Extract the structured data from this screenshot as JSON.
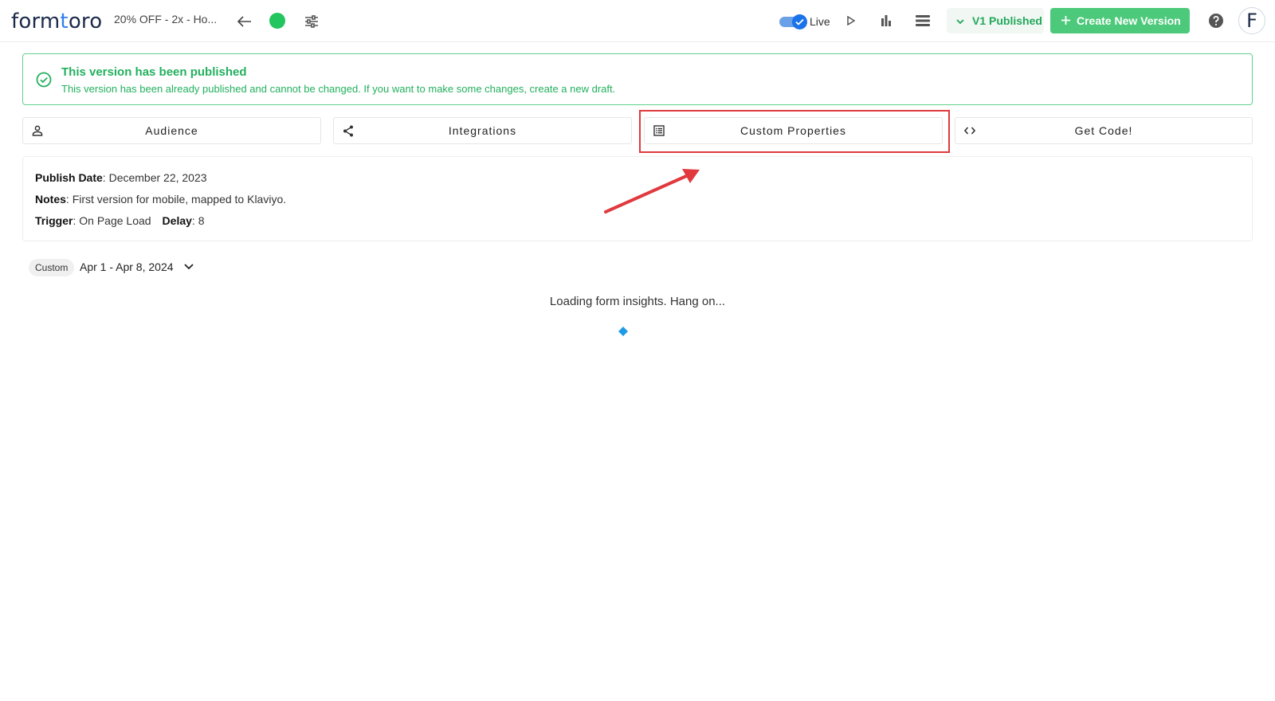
{
  "header": {
    "logo_prefix": "form",
    "logo_mid": "t",
    "logo_suffix": "oro",
    "form_name": "20% OFF - 2x - Ho...",
    "live_label": "Live",
    "version_label": "V1 Published",
    "create_label": "Create New Version",
    "avatar_letter": "F",
    "status_color": "#22c55e"
  },
  "notice": {
    "title": "This version has been published",
    "text": "This version has been already published and cannot be changed. If you want to make some changes, create a new draft."
  },
  "tabs": [
    {
      "label": "Audience",
      "icon": "person-icon"
    },
    {
      "label": "Integrations",
      "icon": "share-icon"
    },
    {
      "label": "Custom Properties",
      "icon": "list-alt-icon"
    },
    {
      "label": "Get Code!",
      "icon": "code-icon"
    }
  ],
  "info": {
    "publish_date_label": "Publish Date",
    "publish_date": "December 22, 2023",
    "notes_label": "Notes",
    "notes": "First version for mobile, mapped to Klaviyo.",
    "trigger_label": "Trigger",
    "trigger": "On Page Load",
    "delay_label": "Delay",
    "delay": "8"
  },
  "date_filter": {
    "chip": "Custom",
    "range": "Apr 1 - Apr 8, 2024"
  },
  "loading": {
    "text": "Loading form insights. Hang on..."
  },
  "colors": {
    "accent_green": "#22b05e",
    "button_green": "#4cc97a",
    "highlight_red": "#e0393e",
    "toggle_blue": "#1a73e8",
    "spinner_blue": "#1e9be6"
  }
}
